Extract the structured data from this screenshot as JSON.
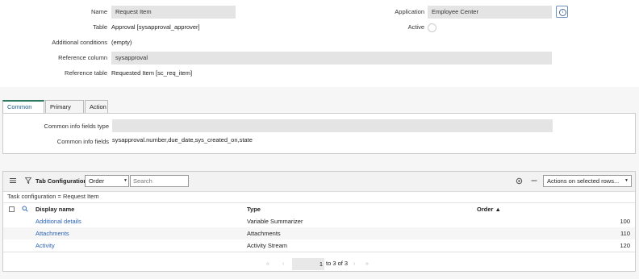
{
  "form": {
    "name_label": "Name",
    "name_value": "Request Item",
    "application_label": "Application",
    "application_value": "Employee Center",
    "table_label": "Table",
    "table_value": "Approval [sysapproval_approver]",
    "active_label": "Active",
    "additional_conditions_label": "Additional conditions",
    "additional_conditions_value": "(empty)",
    "reference_column_label": "Reference column",
    "reference_column_value": "sysapproval",
    "reference_table_label": "Reference table",
    "reference_table_value": "Requested Item [sc_req_item]"
  },
  "tabs": [
    {
      "label": "Common Info",
      "active": true
    },
    {
      "label": "Primary Info",
      "active": false
    },
    {
      "label": "Action",
      "active": false
    }
  ],
  "common_info": {
    "fields_type_label": "Common info fields type",
    "fields_type_value": "",
    "fields_label": "Common info fields",
    "fields_value": "sysapproval.number,due_date,sys_created_on,state"
  },
  "related_list": {
    "title": "Tab Configurations",
    "order_select": "Order",
    "search_placeholder": "Search",
    "actions_select": "Actions on selected rows...",
    "breadcrumb": "Task configuration = Request Item",
    "columns": {
      "display_name": "Display name",
      "type": "Type",
      "order": "Order ▲"
    },
    "rows": [
      {
        "display_name": "Additional details",
        "type": "Variable Summarizer",
        "order": "100"
      },
      {
        "display_name": "Attachments",
        "type": "Attachments",
        "order": "110"
      },
      {
        "display_name": "Activity",
        "type": "Activity Stream",
        "order": "120"
      }
    ],
    "pager": {
      "page_value": "1",
      "range_text": "to 3 of 3"
    }
  },
  "icons": {
    "info": "info-icon",
    "menu": "hamburger-icon",
    "filter": "filter-icon",
    "search": "search-icon",
    "gear": "gear-icon",
    "minus": "minus-icon",
    "first": "first-page-icon",
    "prev": "previous-page-icon",
    "next": "next-page-icon",
    "last": "last-page-icon"
  },
  "colors": {
    "link": "#2b62b0",
    "active_tab": "#2d7a5f",
    "field_bg": "#e4e4e4"
  }
}
